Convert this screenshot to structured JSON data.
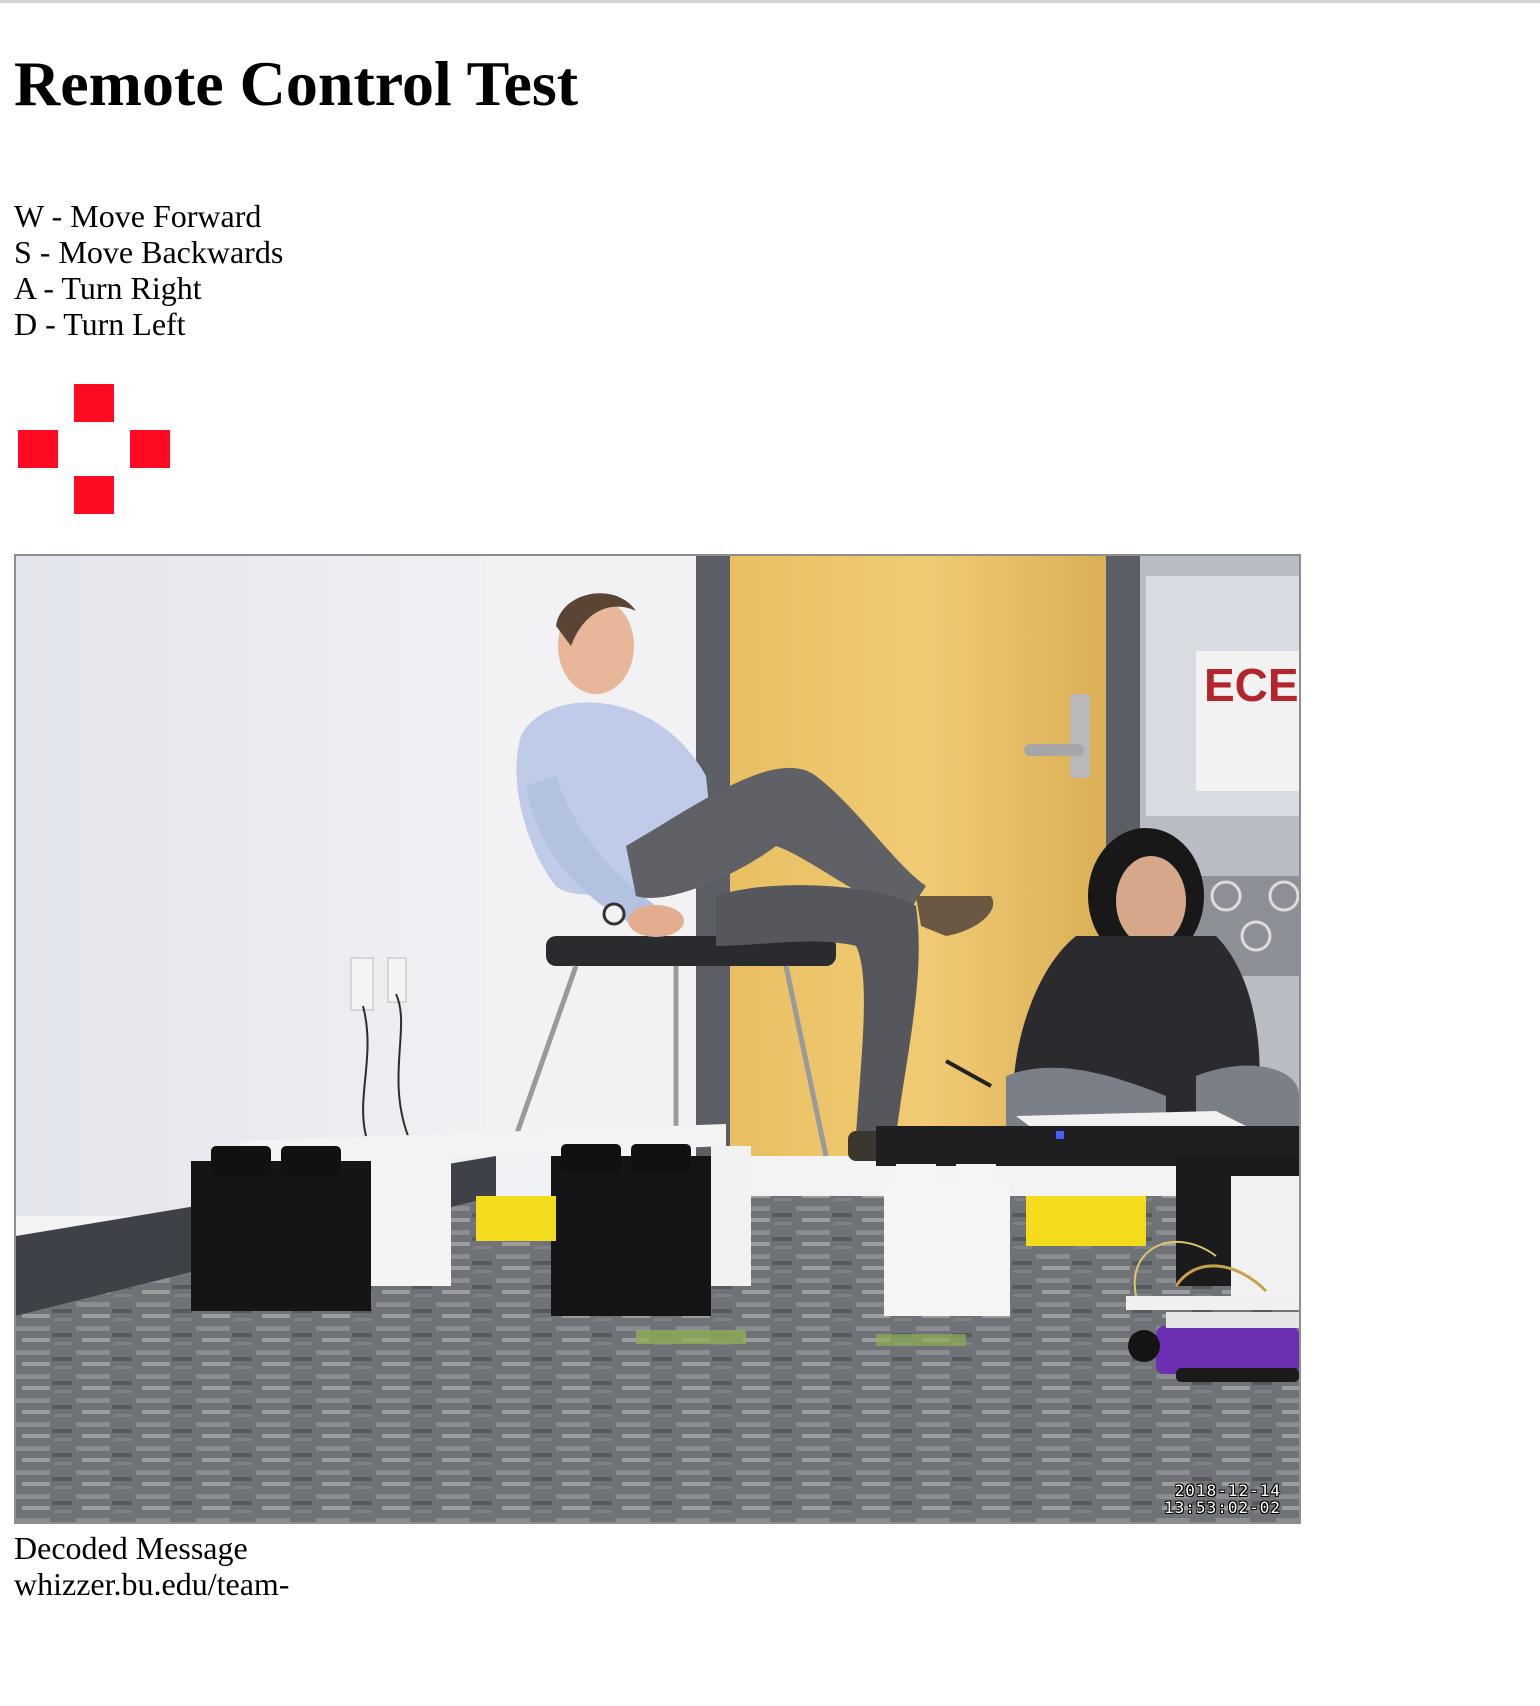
{
  "page": {
    "title": "Remote Control Test"
  },
  "controls": [
    {
      "key": "W",
      "action": "Move Forward",
      "text": "W - Move Forward"
    },
    {
      "key": "S",
      "action": "Move Backwards",
      "text": "S - Move Backwards"
    },
    {
      "key": "A",
      "action": "Turn Right",
      "text": "A - Turn Right"
    },
    {
      "key": "D",
      "action": "Turn Left",
      "text": "D - Turn Left"
    }
  ],
  "dpad": {
    "color": "#ff0a22",
    "icons": [
      "arrow-up-key-icon",
      "arrow-left-key-icon",
      "arrow-right-key-icon",
      "arrow-down-key-icon"
    ]
  },
  "camera": {
    "timestamp_date": "2018-12-14",
    "timestamp_time": "13:53:02-02",
    "wall_sign": "ECE"
  },
  "decoded": {
    "label": "Decoded Message",
    "value": "whizzer.bu.edu/team-"
  }
}
